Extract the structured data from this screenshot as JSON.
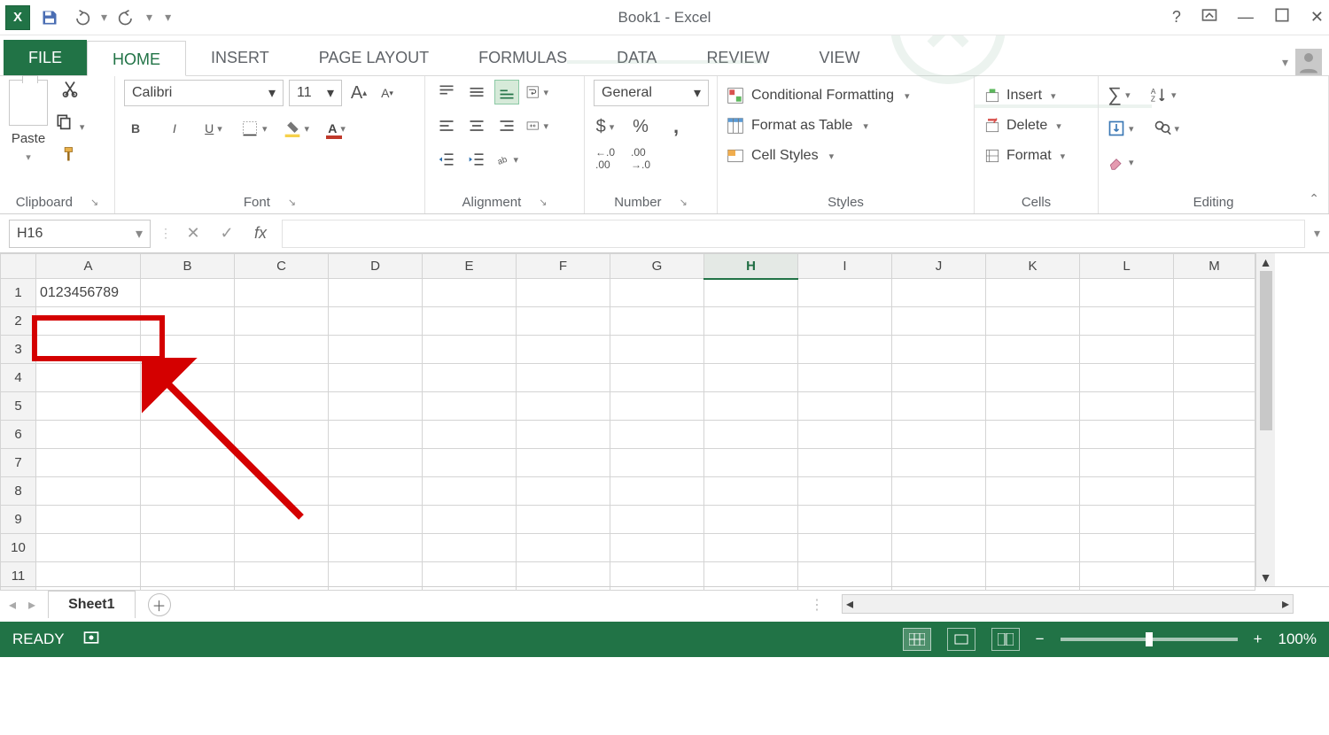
{
  "titlebar": {
    "title": "Book1 - Excel"
  },
  "qat": {
    "save_tip": "Save",
    "undo_tip": "Undo",
    "redo_tip": "Redo"
  },
  "tabs": {
    "file": "FILE",
    "home": "HOME",
    "insert": "INSERT",
    "page_layout": "PAGE LAYOUT",
    "formulas": "FORMULAS",
    "data": "DATA",
    "review": "REVIEW",
    "view": "VIEW"
  },
  "ribbon": {
    "clipboard": {
      "paste": "Paste",
      "label": "Clipboard"
    },
    "font": {
      "name": "Calibri",
      "size": "11",
      "label": "Font"
    },
    "alignment": {
      "label": "Alignment"
    },
    "number": {
      "format": "General",
      "label": "Number"
    },
    "styles": {
      "cond": "Conditional Formatting",
      "table": "Format as Table",
      "cell": "Cell Styles",
      "label": "Styles"
    },
    "cells": {
      "insert": "Insert",
      "delete": "Delete",
      "format": "Format",
      "label": "Cells"
    },
    "editing": {
      "label": "Editing"
    }
  },
  "formula_bar": {
    "name_box": "H16",
    "fx": "fx",
    "formula": ""
  },
  "grid": {
    "columns": [
      "A",
      "B",
      "C",
      "D",
      "E",
      "F",
      "G",
      "H",
      "I",
      "J",
      "K",
      "L",
      "M"
    ],
    "active_column": "H",
    "rows": [
      1,
      2,
      3,
      4,
      5,
      6,
      7,
      8,
      9,
      10,
      11
    ],
    "cells": {
      "A1": "0123456789"
    }
  },
  "sheet_tabs": {
    "active": "Sheet1"
  },
  "statusbar": {
    "ready": "READY",
    "zoom": "100%"
  }
}
